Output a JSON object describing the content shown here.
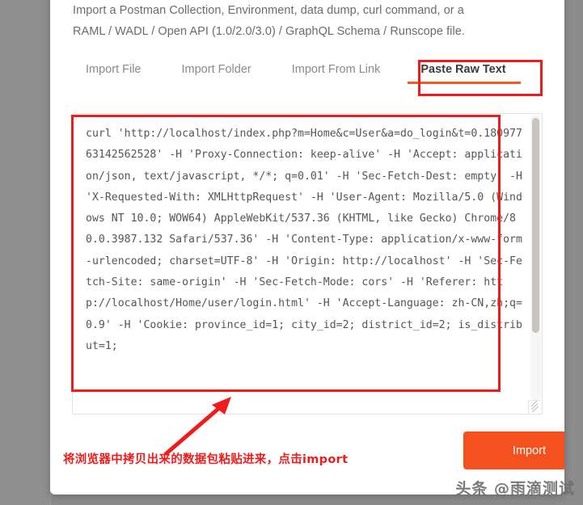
{
  "modal": {
    "description_line1": "Import a Postman Collection, Environment, data dump, curl command, or a",
    "description_line2": "RAML / WADL / Open API (1.0/2.0/3.0) / GraphQL Schema / Runscope file.",
    "tabs": [
      {
        "label": "Import File",
        "active": false
      },
      {
        "label": "Import Folder",
        "active": false
      },
      {
        "label": "Import From Link",
        "active": false
      },
      {
        "label": "Paste Raw Text",
        "active": true
      }
    ],
    "textarea": {
      "value": "curl 'http://localhost/index.php?m=Home&c=User&a=do_login&t=0.18097763142562528' -H 'Proxy-Connection: keep-alive' -H 'Accept: application/json, text/javascript, */*; q=0.01' -H 'Sec-Fetch-Dest: empty' -H 'X-Requested-With: XMLHttpRequest' -H 'User-Agent: Mozilla/5.0 (Windows NT 10.0; WOW64) AppleWebKit/537.36 (KHTML, like Gecko) Chrome/80.0.3987.132 Safari/537.36' -H 'Content-Type: application/x-www-form-urlencoded; charset=UTF-8' -H 'Origin: http://localhost' -H 'Sec-Fetch-Site: same-origin' -H 'Sec-Fetch-Mode: cors' -H 'Referer: http://localhost/Home/user/login.html' -H 'Accept-Language: zh-CN,zh;q=0.9' -H 'Cookie: province_id=1; city_id=2; district_id=2; is_distribut=1;",
      "placeholder": "",
      "scroll_position_percent": 0
    },
    "import_button_label": "Import"
  },
  "annotations": {
    "bottom_note": "将浏览器中拷贝出来的数据包粘贴进来，点击import",
    "highlight_color": "#ee1c1c"
  },
  "watermark": "头条 @雨滴测试",
  "colors": {
    "accent_orange": "#f4511e",
    "tab_underline": "#f15a22",
    "annotation_red": "#ee1c1c",
    "backdrop_gray": "#8c8c8c",
    "text_gray": "#6b6b6b"
  }
}
